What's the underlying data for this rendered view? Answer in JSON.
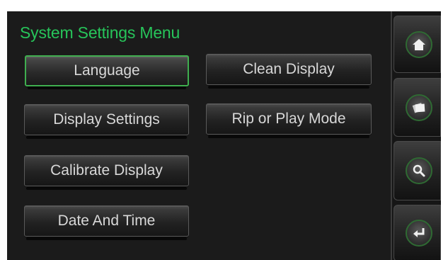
{
  "menu": {
    "title": "System Settings Menu",
    "buttons": {
      "language": "Language",
      "clean_display": "Clean Display",
      "display_settings": "Display Settings",
      "rip_or_play_mode": "Rip or Play Mode",
      "calibrate_display": "Calibrate Display",
      "date_and_time": "Date And Time"
    },
    "selected": "Language"
  },
  "sidebar": {
    "items": [
      {
        "icon": "home-icon"
      },
      {
        "icon": "albums-icon"
      },
      {
        "icon": "search-icon"
      },
      {
        "icon": "back-icon"
      }
    ]
  },
  "colors": {
    "title": "#27c45a",
    "selected_border": "#3fae4f",
    "icon_ring": "#2f6a33",
    "background": "#1b1b1b"
  }
}
